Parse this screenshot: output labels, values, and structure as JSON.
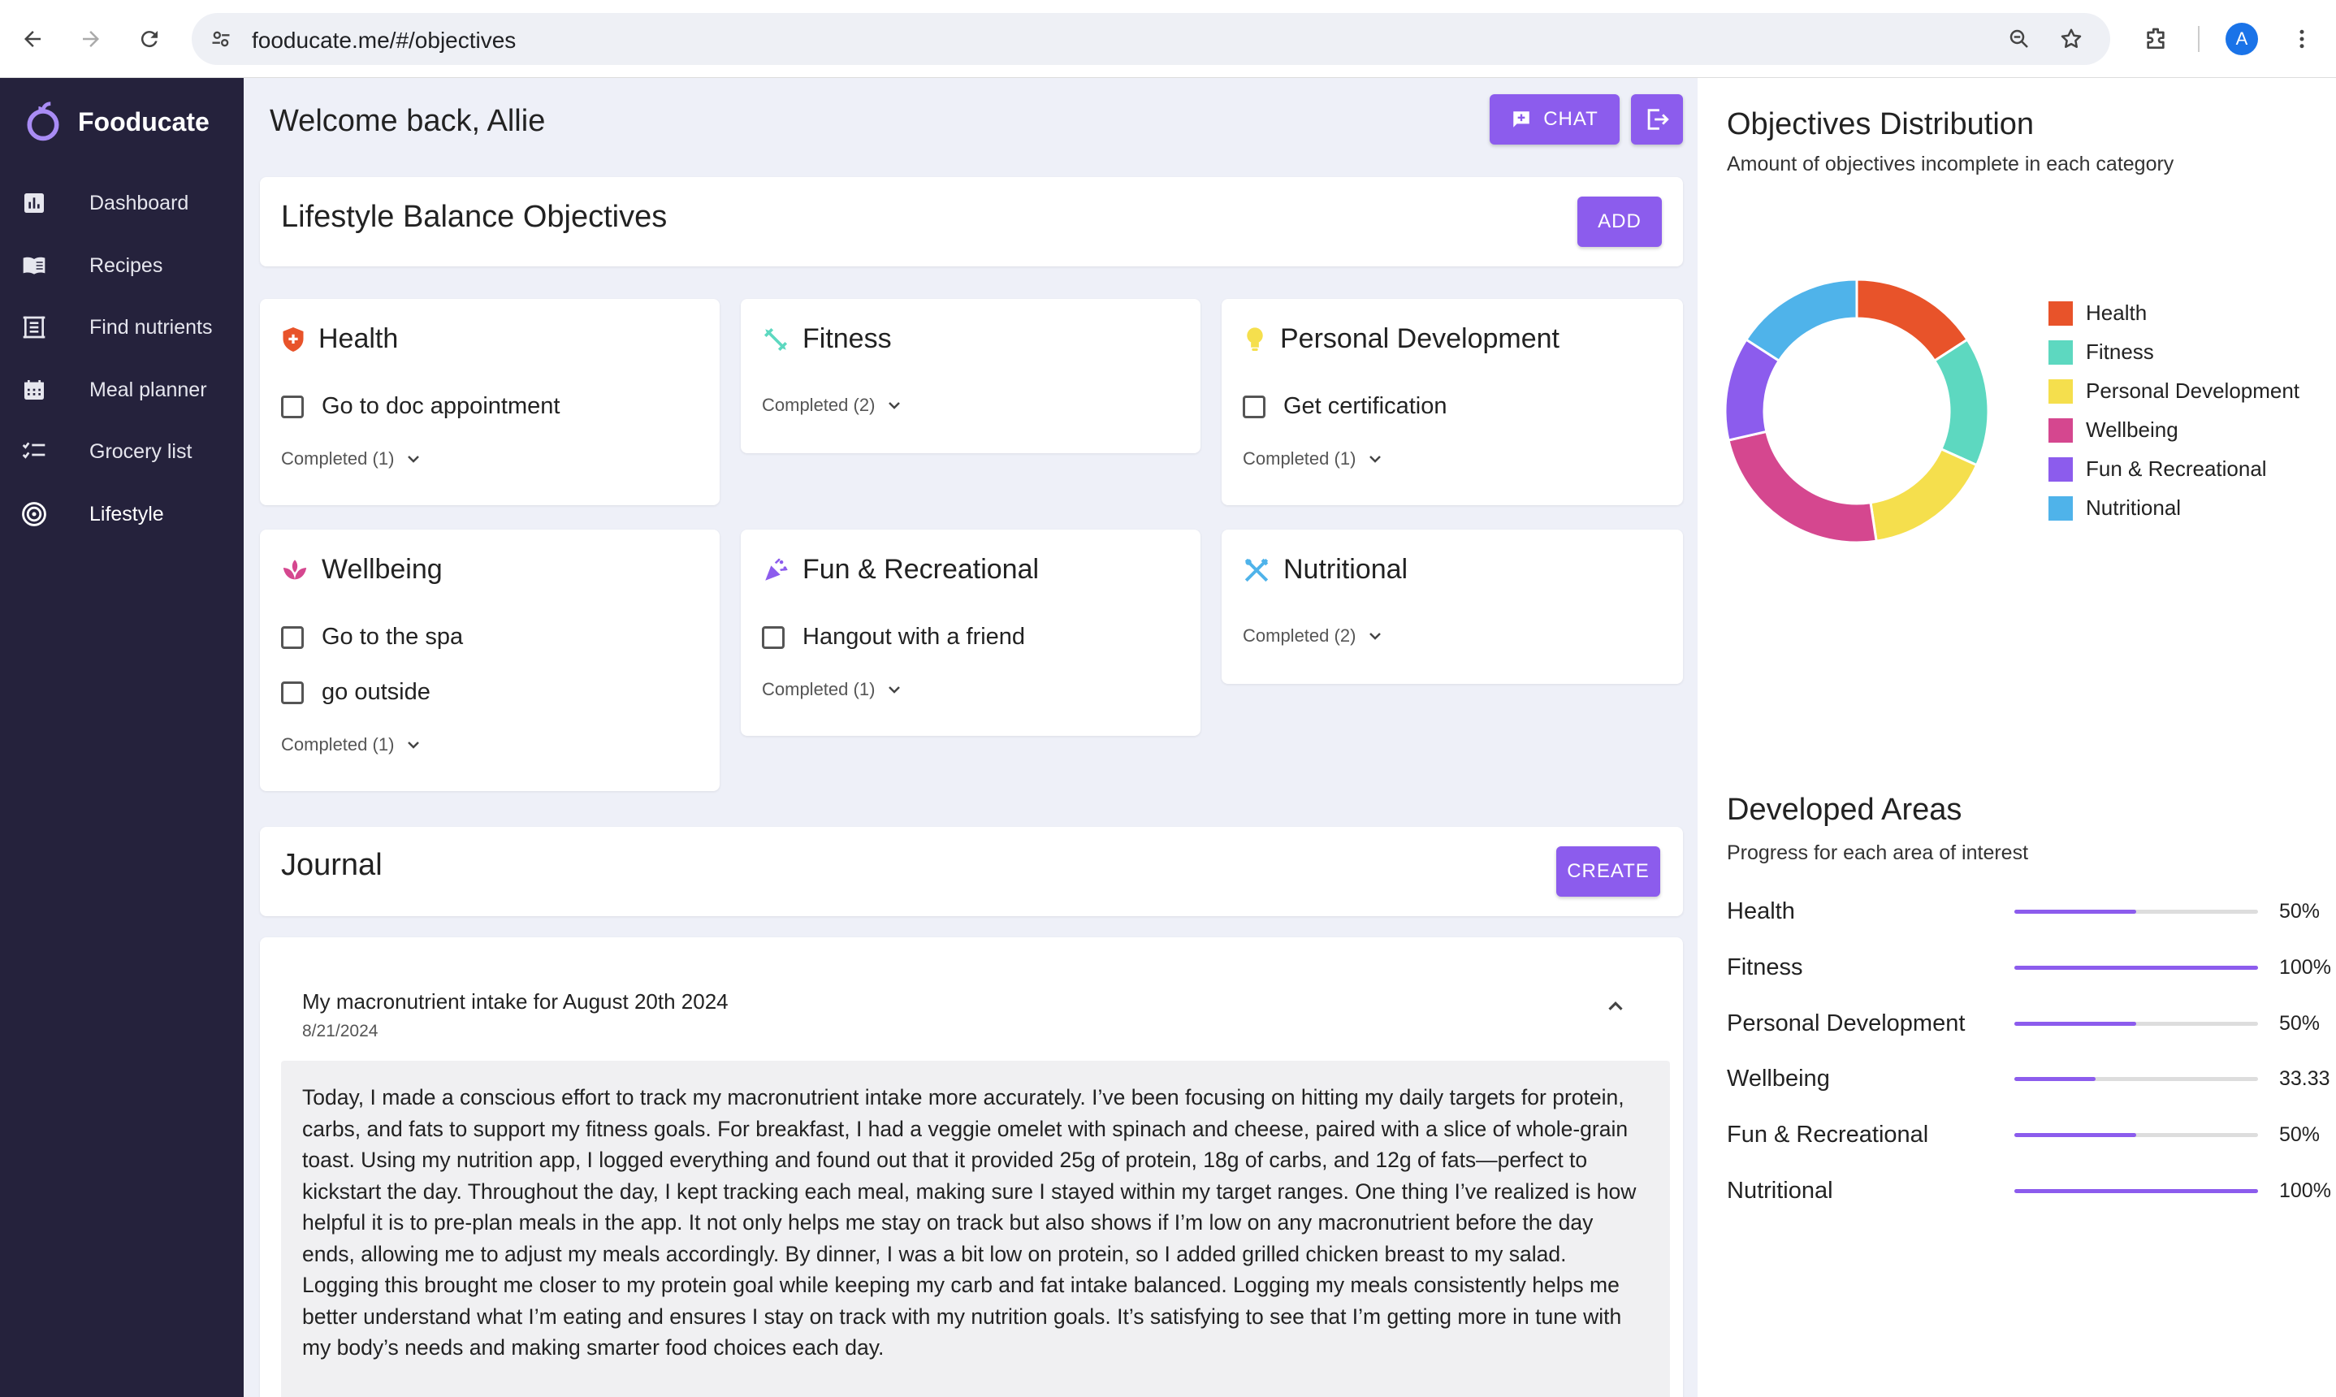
{
  "browser": {
    "url": "fooducate.me/#/objectives",
    "avatar_letter": "A"
  },
  "sidebar": {
    "brand": "Fooducate",
    "items": [
      {
        "label": "Dashboard",
        "icon": "bar-chart-icon"
      },
      {
        "label": "Recipes",
        "icon": "book-icon"
      },
      {
        "label": "Find nutrients",
        "icon": "receipt-icon"
      },
      {
        "label": "Meal planner",
        "icon": "calendar-icon"
      },
      {
        "label": "Grocery list",
        "icon": "checklist-icon"
      },
      {
        "label": "Lifestyle",
        "icon": "target-icon"
      }
    ]
  },
  "header": {
    "welcome": "Welcome back, Allie",
    "chat_label": "CHAT"
  },
  "objectives": {
    "title": "Lifestyle Balance Objectives",
    "add_label": "ADD",
    "categories": [
      {
        "name": "Health",
        "tasks": [
          "Go to doc appointment"
        ],
        "completed": "Completed (1)",
        "color": "#e8532a"
      },
      {
        "name": "Fitness",
        "tasks": [],
        "completed": "Completed (2)",
        "color": "#5dd8c0"
      },
      {
        "name": "Personal Development",
        "tasks": [
          "Get certification"
        ],
        "completed": "Completed (1)",
        "color": "#f5df4d"
      },
      {
        "name": "Wellbeing",
        "tasks": [
          "Go to the spa",
          "go outside"
        ],
        "completed": "Completed (1)",
        "color": "#d5478f"
      },
      {
        "name": "Fun & Recreational",
        "tasks": [
          "Hangout with a friend"
        ],
        "completed": "Completed (1)",
        "color": "#8c5ced"
      },
      {
        "name": "Nutritional",
        "tasks": [],
        "completed": "Completed (2)",
        "color": "#4fb3ea"
      }
    ]
  },
  "journal": {
    "title": "Journal",
    "create_label": "CREATE",
    "entry": {
      "title": "My macronutrient intake for August 20th 2024",
      "date": "8/21/2024",
      "body": "Today, I made a conscious effort to track my macronutrient intake more accurately. I’ve been focusing on hitting my daily targets for protein, carbs, and fats to support my fitness goals. For breakfast, I had a veggie omelet with spinach and cheese, paired with a slice of whole-grain toast. Using my nutrition app, I logged everything and found out that it provided 25g of protein, 18g of carbs, and 12g of fats—perfect to kickstart the day. Throughout the day, I kept tracking each meal, making sure I stayed within my target ranges. One thing I’ve realized is how helpful it is to pre-plan meals in the app. It not only helps me stay on track but also shows if I’m low on any macronutrient before the day ends, allowing me to adjust my meals accordingly. By dinner, I was a bit low on protein, so I added grilled chicken breast to my salad. Logging this brought me closer to my protein goal while keeping my carb and fat intake balanced. Logging my meals consistently helps me better understand what I’m eating and ensures I stay on track with my nutrition goals. It’s satisfying to see that I’m getting more in tune with my body’s needs and making smarter food choices each day."
    }
  },
  "distribution": {
    "title": "Objectives Distribution",
    "subtitle": "Amount of objectives incomplete in each category"
  },
  "chart_data": {
    "type": "pie",
    "donut": true,
    "labels": [
      "Health",
      "Fitness",
      "Personal Development",
      "Wellbeing",
      "Fun & Recreational",
      "Nutritional"
    ],
    "values": [
      1,
      1,
      1,
      1.5,
      0.8,
      1
    ],
    "colors": [
      "#e8532a",
      "#5dd8c0",
      "#f5df4d",
      "#d5478f",
      "#8c5ced",
      "#4fb3ea"
    ],
    "legend": "right"
  },
  "developed": {
    "title": "Developed Areas",
    "subtitle": "Progress for each area of interest",
    "rows": [
      {
        "label": "Health",
        "value_text": "50%",
        "fraction": 0.5
      },
      {
        "label": "Fitness",
        "value_text": "100%",
        "fraction": 1.0
      },
      {
        "label": "Personal Development",
        "value_text": "50%",
        "fraction": 0.5
      },
      {
        "label": "Wellbeing",
        "value_text": "33.33",
        "fraction": 0.3333
      },
      {
        "label": "Fun & Recreational",
        "value_text": "50%",
        "fraction": 0.5
      },
      {
        "label": "Nutritional",
        "value_text": "100%",
        "fraction": 1.0
      }
    ]
  }
}
